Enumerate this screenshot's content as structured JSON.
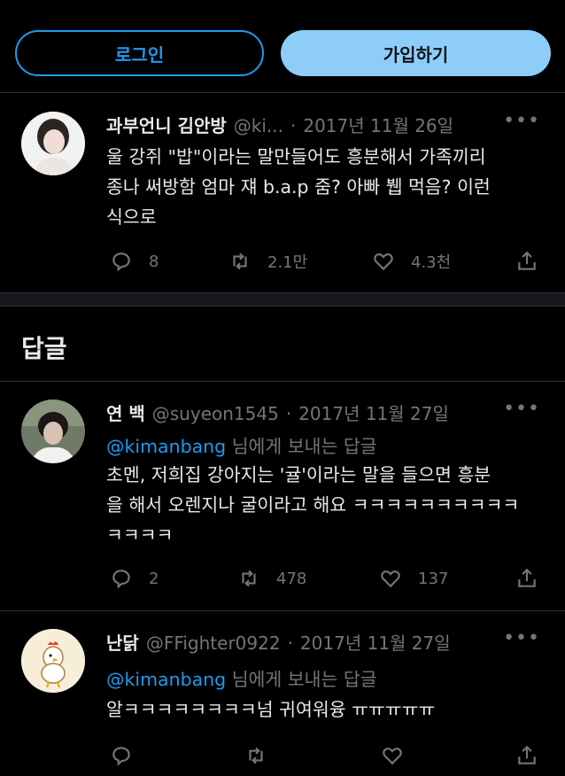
{
  "topbar": {
    "login_label": "로그인",
    "signup_label": "가입하기"
  },
  "main_tweet": {
    "name": "과부언니 김안방",
    "handle": "@ki...",
    "date": "2017년 11월 26일",
    "text": "울 강쥐 \"밥\"이라는 말만들어도 흥분해서 가족끼리\n종나 써방함 엄마 쟤  b.a.p 줌? 아빠 뷉 먹음? 이런\n식으로",
    "replies": "8",
    "retweets": "2.1만",
    "likes": "4.3천"
  },
  "replies_section": {
    "title": "답글"
  },
  "reply1": {
    "name": "연 백",
    "handle": "@suyeon1545",
    "date": "2017년 11월 27일",
    "reply_to_mention": "@kimanbang",
    "reply_to_suffix": " 님에게 보내는 답글",
    "text": "초멘, 저희집 강아지는 '귤'이라는 말을 들으면 흥분\n을 해서 오렌지나 굴이라고 해요 ㅋㅋㅋㅋㅋㅋㅋㅋㅋㅋ\nㅋㅋㅋㅋ",
    "replies": "2",
    "retweets": "478",
    "likes": "137"
  },
  "reply2": {
    "name": "난닭",
    "handle": "@FFighter0922",
    "date": "2017년 11월 27일",
    "reply_to_mention": "@kimanbang",
    "reply_to_suffix": " 님에게 보내는 답글",
    "text": "알ㅋㅋㅋㅋㅋㅋㅋㅋ넘 귀여워융 ㅠㅠㅠㅠㅠ"
  },
  "colors": {
    "accent": "#1d9bf0",
    "secondary_text": "#71767b",
    "background": "#000000"
  }
}
